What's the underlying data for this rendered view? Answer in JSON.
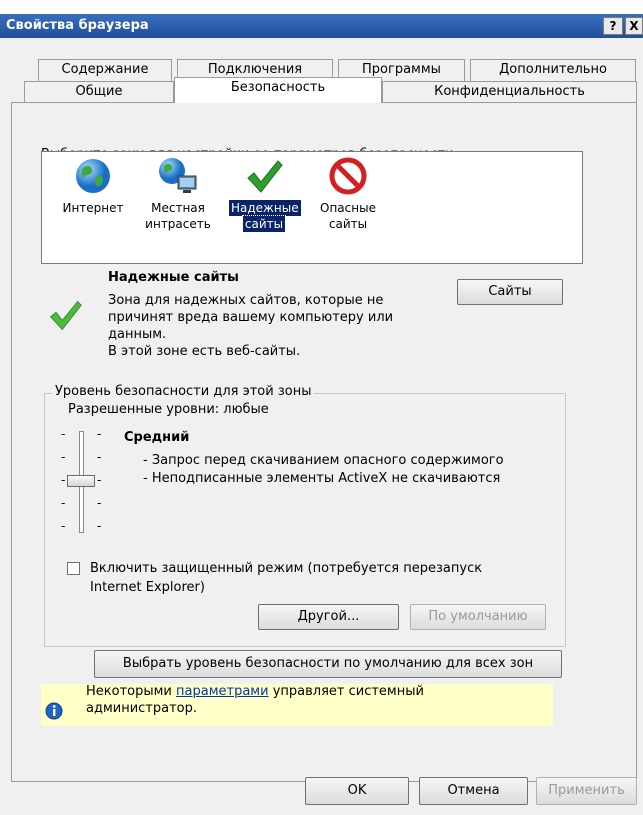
{
  "window": {
    "title": "Свойства браузера",
    "help": "?",
    "close": "X"
  },
  "tabs_top": [
    "Содержание",
    "Подключения",
    "Программы",
    "Дополнительно"
  ],
  "tabs_bottom": [
    "Общие",
    "Безопасность",
    "Конфиденциальность"
  ],
  "zone_prompt": "Выберите зону для настройки ее параметров безопасности.",
  "zones": [
    {
      "line1": "Интернет",
      "line2": "",
      "icon": "globe-icon"
    },
    {
      "line1": "Местная",
      "line2": "интрасеть",
      "icon": "intranet-icon"
    },
    {
      "line1": "Надежные",
      "line2": "сайты",
      "icon": "checkmark-icon",
      "selected": true
    },
    {
      "line1": "Опасные",
      "line2": "сайты",
      "icon": "no-entry-icon"
    }
  ],
  "zone_info": {
    "title": "Надежные сайты",
    "desc1": "Зона для надежных сайтов, которые не",
    "desc2": "причинят вреда вашему компьютеру или",
    "desc3": "данным.",
    "desc4": "В этой зоне есть веб-сайты.",
    "sites_button": "Сайты"
  },
  "level": {
    "legend": "Уровень безопасности для этой зоны",
    "allowed": "Разрешенные уровни: любые",
    "name": "Средний",
    "line1": "- Запрос перед скачиванием опасного содержимого",
    "line2": "- Неподписанные элементы ActiveX не скачиваются",
    "slider_position": "3 of 5"
  },
  "protected_mode": {
    "label1": "Включить защищенный режим (потребуется перезапуск",
    "label2": "Internet Explorer)",
    "checked": false
  },
  "buttons": {
    "custom": "Другой...",
    "default": "По умолчанию",
    "default_all": "Выбрать уровень безопасности по умолчанию для всех зон",
    "ok": "OK",
    "cancel": "Отмена",
    "apply": "Применить"
  },
  "info": {
    "pre": "Некоторыми ",
    "link": "параметрами",
    "post": " управляет системный",
    "line2": "администратор."
  },
  "colors": {
    "titlebar": "#2b5ca5",
    "selection": "#0a246a",
    "info_bg": "#ffffc8",
    "check_green": "#2e9e2e",
    "danger_red": "#d42020"
  }
}
